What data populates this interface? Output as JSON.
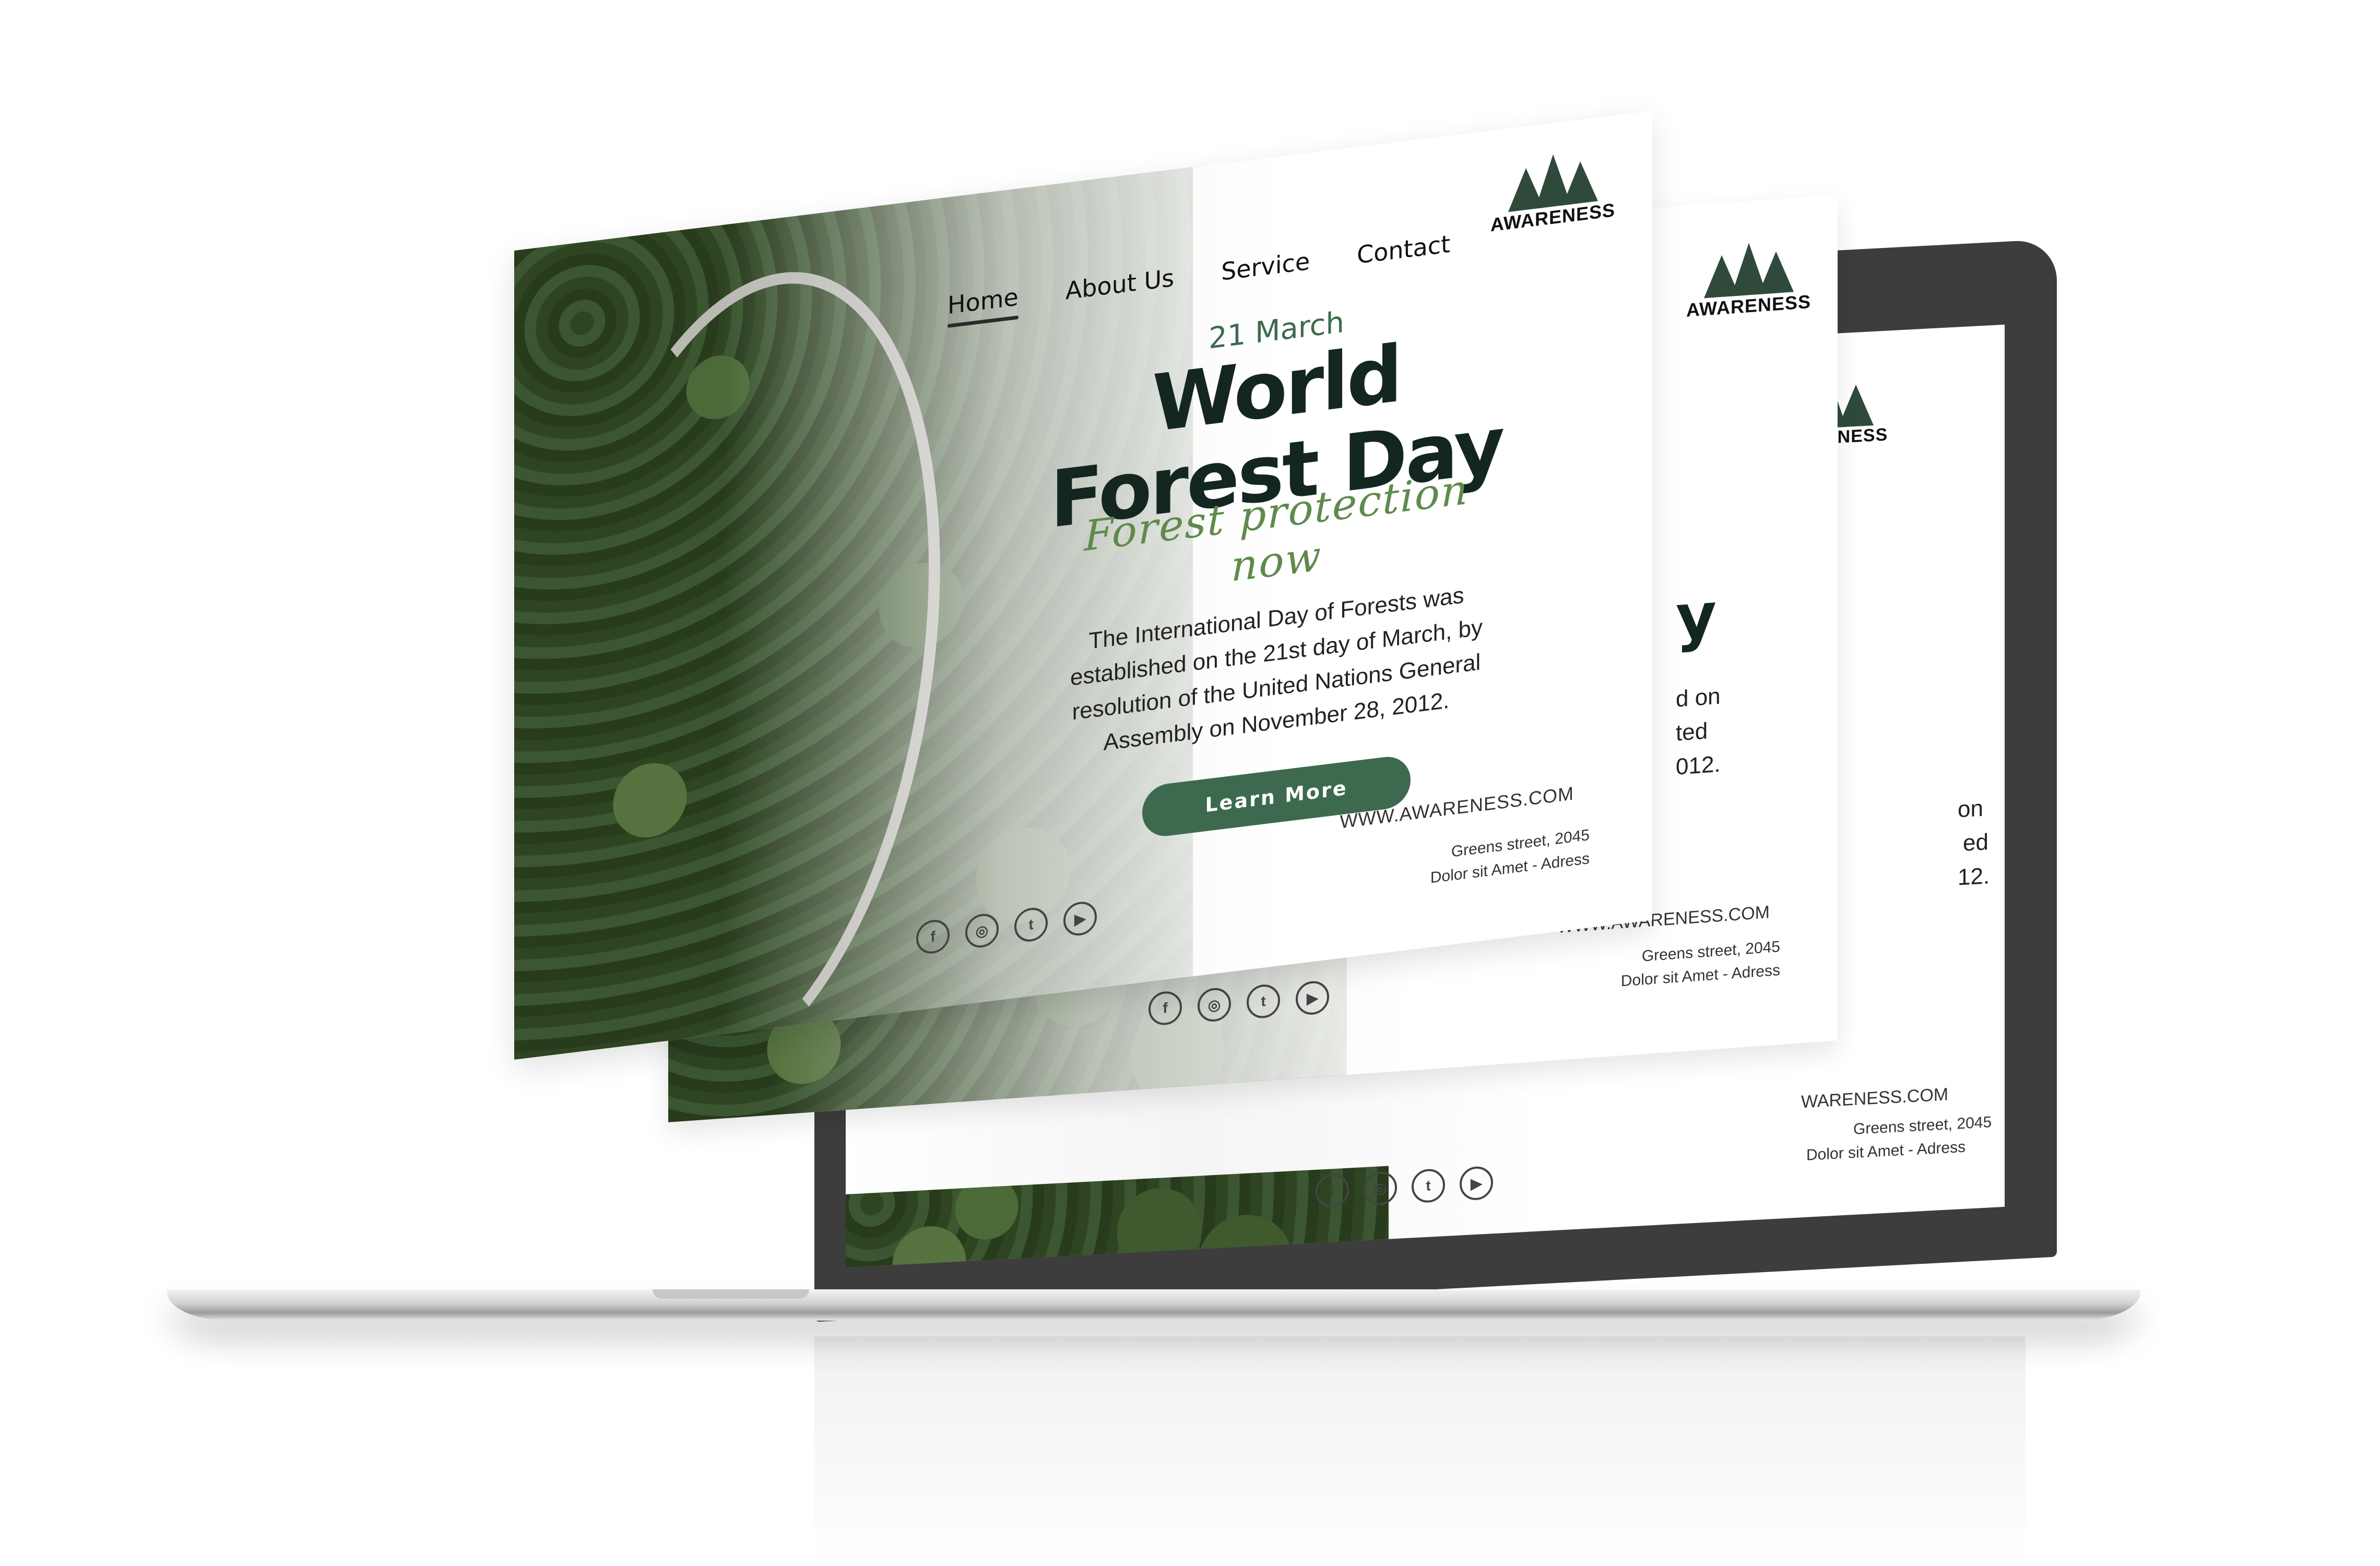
{
  "brand": {
    "logo_text": "AWARENESS"
  },
  "nav": {
    "items": [
      {
        "label": "Home"
      },
      {
        "label": "About Us"
      },
      {
        "label": "Service"
      },
      {
        "label": "Contact"
      }
    ]
  },
  "hero": {
    "date": "21 March",
    "title_line1": "World",
    "title_line2": "Forest Day",
    "script": "Forest protection now",
    "description": "The International Day of Forests was established on the 21st day of March, by resolution of the United Nations General Assembly on November 28, 2012.",
    "cta": "Learn More"
  },
  "footer": {
    "url": "WWW.AWARENESS.COM",
    "address_line1": "Greens street, 2045",
    "address_line2": "Dolor sit Amet - Adress"
  },
  "middle_page": {
    "title_fragment": "y",
    "desc_fragment1": "d on",
    "desc_fragment2": "ted",
    "desc_fragment3": "012."
  },
  "back_page": {
    "url_fragment": "WARENESS.COM",
    "desc_fragment1": "on",
    "desc_fragment2": "ed",
    "desc_fragment3": "12."
  },
  "social": [
    {
      "icon": "facebook-icon",
      "glyph": "f"
    },
    {
      "icon": "instagram-icon",
      "glyph": "◎"
    },
    {
      "icon": "twitter-icon",
      "glyph": "t"
    },
    {
      "icon": "youtube-icon",
      "glyph": "▶"
    }
  ],
  "colors": {
    "accent": "#3d6a4e",
    "title": "#142620",
    "script": "#5f8a4c",
    "laptop": "#3d3d3d"
  }
}
